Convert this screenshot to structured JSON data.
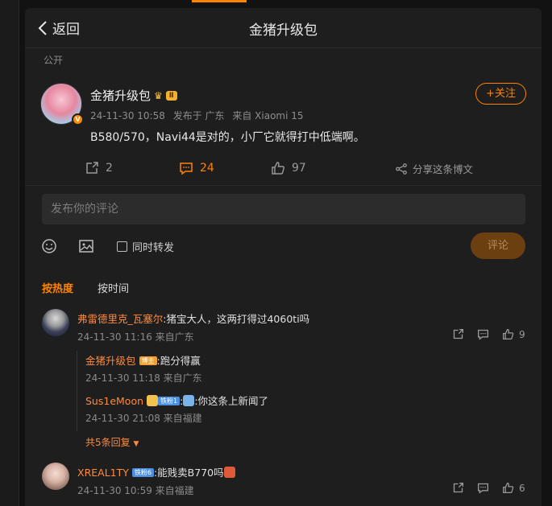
{
  "header": {
    "back_label": "返回",
    "title": "金猪升级包"
  },
  "visibility": "公开",
  "post": {
    "author": "金猪升级包",
    "level_badge": "Ⅱ",
    "verified_badge": "V",
    "time": "24-11-30 10:58",
    "location": "发布于 广东",
    "device": "来自 Xiaomi 15",
    "text": "B580/570，Navi44是对的，小厂它就得打中低端啊。",
    "follow_label": "+关注",
    "repost_count": "2",
    "comment_count": "24",
    "like_count": "97",
    "share_label": "分享这条博文"
  },
  "composer": {
    "placeholder": "发布你的评论",
    "repost_label": "同时转发",
    "submit_label": "评论"
  },
  "sort": {
    "hot": "按热度",
    "time": "按时间"
  },
  "comments": [
    {
      "user": "弗雷德里克_瓦塞尔",
      "text": ":猪宝大人，这两打得过4060ti吗",
      "meta": "24-11-30 11:16 来自广东",
      "likes": "9",
      "replies": [
        {
          "user": "金猪升级包",
          "tag": "博主",
          "text": ":跑分得赢",
          "meta": "24-11-30 11:18 来自广东"
        },
        {
          "user": "Sus1eMoon",
          "tag": "铁粉1",
          "text": ":你这条上新闻了",
          "meta": "24-11-30 21:08 来自福建"
        }
      ],
      "more_label": "共5条回复"
    },
    {
      "user": "XREAL1TY",
      "tag": "铁粉6",
      "text": ":能贱卖B770吗",
      "meta": "24-11-30 10:59 来自福建",
      "likes": "6"
    }
  ],
  "colors": {
    "accent": "#ff8200",
    "panel": "#1e1e1e",
    "bg": "#121212"
  }
}
